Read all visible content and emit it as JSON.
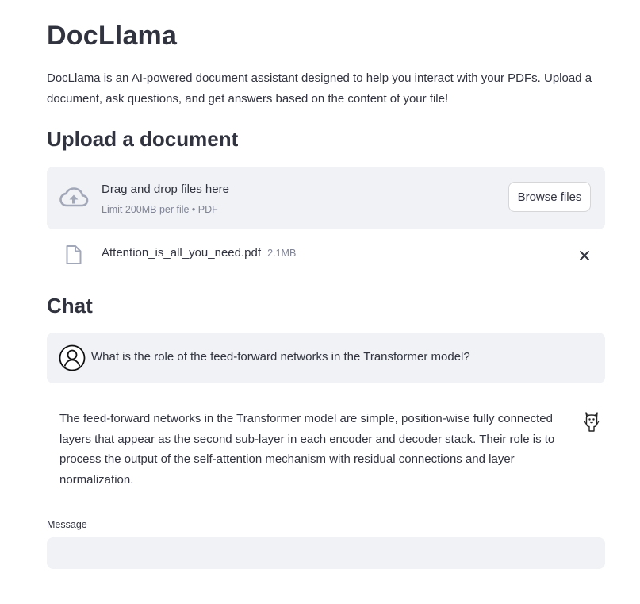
{
  "app": {
    "title": "DocLlama",
    "description": "DocLlama is an AI-powered document assistant designed to help you interact with your PDFs. Upload a document, ask questions, and get answers based on the content of your file!"
  },
  "upload": {
    "heading": "Upload a document",
    "dropzone": {
      "icon": "cloud-upload-icon",
      "title": "Drag and drop files here",
      "limit": "Limit 200MB per file • PDF"
    },
    "browse_label": "Browse files",
    "file": {
      "icon": "file-icon",
      "name": "Attention_is_all_you_need.pdf",
      "size": "2.1MB",
      "remove_icon": "close-icon"
    }
  },
  "chat": {
    "heading": "Chat",
    "messages": [
      {
        "role": "user",
        "avatar_icon": "user-avatar-icon",
        "text": "What is the role of the feed-forward networks in the Transformer model?"
      },
      {
        "role": "assistant",
        "avatar_icon": "llama-avatar-icon",
        "text": "The feed-forward networks in the Transformer model are simple, position-wise fully connected layers that appear as the second sub-layer in each encoder and decoder stack. Their role is to process the output of the self-attention mechanism with residual connections and layer normalization."
      }
    ],
    "input": {
      "label": "Message",
      "value": "",
      "placeholder": ""
    }
  },
  "colors": {
    "text": "#31333f",
    "muted": "#808495",
    "surface": "#f0f2f6",
    "icon": "#a3a8b8"
  }
}
